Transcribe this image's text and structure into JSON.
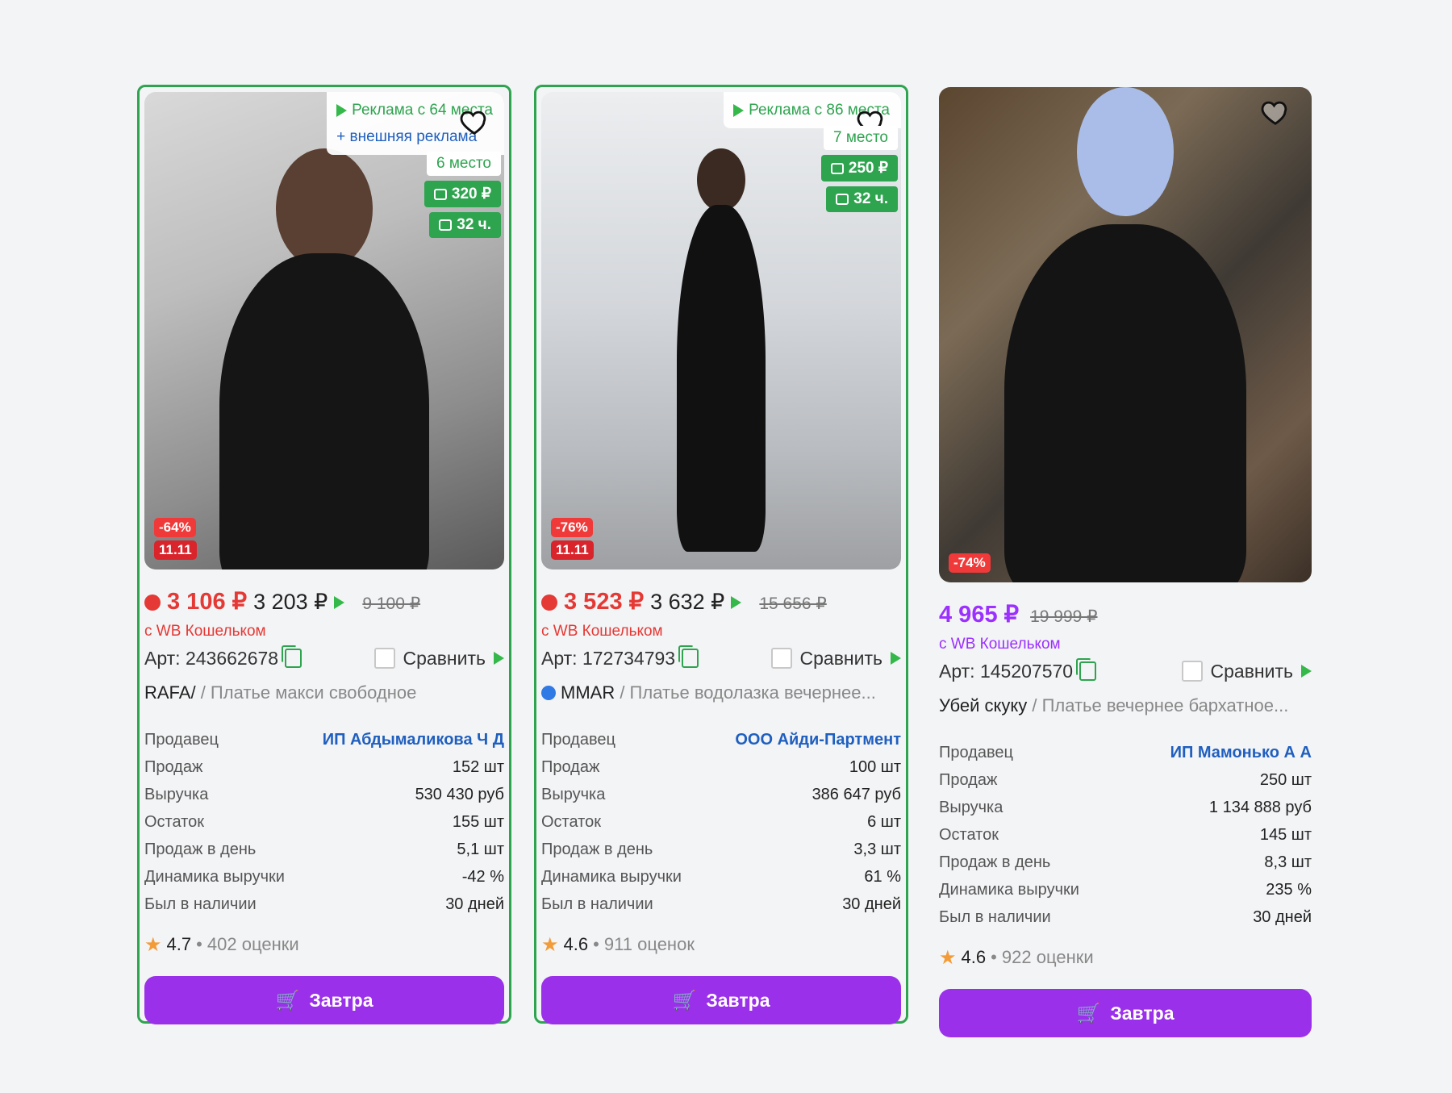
{
  "cards": [
    {
      "ad_label": "Реклама с 64 места",
      "external_ad": "+ внешняя реклама",
      "place": "6 место",
      "cost_badge": "320 ₽",
      "delivery_badge": "32 ч.",
      "discount": "-64%",
      "date_badge": "11.11",
      "price_wallet": "3 106 ₽",
      "price": "3 203 ₽",
      "price_old": "9 100 ₽",
      "wallet_text": "с WB Кошельком",
      "article": "Арт: 243662678",
      "compare_label": "Сравнить",
      "brand": "RAFA/",
      "product_name": " / Платье макси свободное",
      "stats": [
        {
          "k": "Продавец",
          "v": "ИП Абдымаликова Ч Д"
        },
        {
          "k": "Продаж",
          "v": "152 шт"
        },
        {
          "k": "Выручка",
          "v": "530 430 руб"
        },
        {
          "k": "Остаток",
          "v": "155 шт"
        },
        {
          "k": "Продаж в день",
          "v": "5,1 шт"
        },
        {
          "k": "Динамика выручки",
          "v": "-42 %"
        },
        {
          "k": "Был в наличии",
          "v": "30 дней"
        }
      ],
      "rating": "4.7",
      "reviews": "• 402 оценки",
      "buy_label": "Завтра"
    },
    {
      "ad_label": "Реклама с 86 места",
      "place": "7 место",
      "cost_badge": "250 ₽",
      "delivery_badge": "32 ч.",
      "discount": "-76%",
      "date_badge": "11.11",
      "price_wallet": "3 523 ₽",
      "price": "3 632 ₽",
      "price_old": "15 656 ₽",
      "wallet_text": "с WB Кошельком",
      "article": "Арт: 172734793",
      "compare_label": "Сравнить",
      "brand": "MMAR",
      "product_name": " / Платье водолазка вечернее...",
      "stats": [
        {
          "k": "Продавец",
          "v": "ООО Айди-Партмент"
        },
        {
          "k": "Продаж",
          "v": "100 шт"
        },
        {
          "k": "Выручка",
          "v": "386 647 руб"
        },
        {
          "k": "Остаток",
          "v": "6 шт"
        },
        {
          "k": "Продаж в день",
          "v": "3,3 шт"
        },
        {
          "k": "Динамика выручки",
          "v": "61 %"
        },
        {
          "k": "Был в наличии",
          "v": "30 дней"
        }
      ],
      "rating": "4.6",
      "reviews": "• 911 оценок",
      "buy_label": "Завтра"
    },
    {
      "discount": "-74%",
      "price_wallet": "4 965 ₽",
      "price_old": "19 999 ₽",
      "wallet_text": "с WB Кошельком",
      "article": "Арт: 145207570",
      "compare_label": "Сравнить",
      "brand": "Убей скуку",
      "product_name": " / Платье вечернее бархатное...",
      "stats": [
        {
          "k": "Продавец",
          "v": "ИП Мамонько А А"
        },
        {
          "k": "Продаж",
          "v": "250 шт"
        },
        {
          "k": "Выручка",
          "v": "1 134 888 руб"
        },
        {
          "k": "Остаток",
          "v": "145 шт"
        },
        {
          "k": "Продаж в день",
          "v": "8,3 шт"
        },
        {
          "k": "Динамика выручки",
          "v": "235 %"
        },
        {
          "k": "Был в наличии",
          "v": "30 дней"
        }
      ],
      "rating": "4.6",
      "reviews": "• 922 оценки",
      "buy_label": "Завтра"
    }
  ],
  "colors": {
    "promo_border": "#2ea44f",
    "price_red": "#e53935",
    "price_purple": "#9b30ff",
    "button_purple": "#9b30ea",
    "seller_link": "#1f5fbf"
  }
}
